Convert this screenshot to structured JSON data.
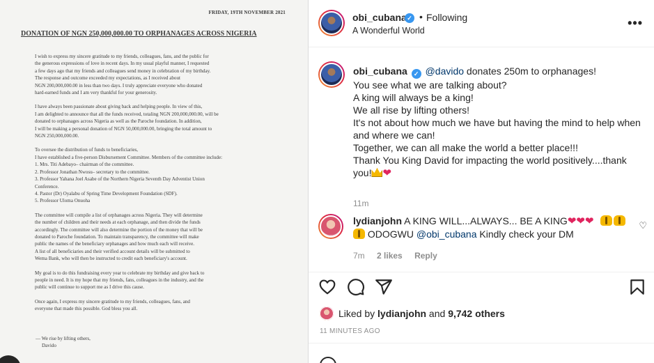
{
  "document": {
    "date": "FRIDAY, 19TH NOVEMBER 2021",
    "title": "DONATION OF NGN 250,000,000.00 TO ORPHANAGES ACROSS NIGERIA",
    "paragraphs": [
      [
        "I wish to express my sincere gratitude to my friends, colleagues, fans, and the public for",
        "the generous expressions of love in recent days. In my usual playful manner, I requested",
        "a few days ago that my friends and colleagues send money in celebration of my birthday.",
        "The response and outcome exceeded my expectations, as I received about",
        "NGN 200,000,000.00 in less than two days. I truly appreciate everyone who donated",
        "hard-earned funds and I am very thankful for your generosity."
      ],
      [
        "I have always been passionate about giving back and helping people. In view of this,",
        "I am delighted to announce that all the funds received, totaling NGN 200,000,000.00, will be",
        "donated to orphanages across Nigeria as well as the Paroche foundation. In addition,",
        "I will be making a personal donation of NGN 50,000,000.00, bringing the total amount to",
        "NGN 250,000,000.00."
      ],
      [
        "To oversee the distribution of funds to beneficiaries,",
        "I have established a five-person Disbursement Committee. Members of the committee include:",
        "1. Mrs. Titi Adebayo– chairman of the committee.",
        "2. Professor Jonathan Nwosu– secretary to the committee.",
        "3. Professor Yahana Joel Asabe of the Northern Nigeria Seventh Day Adventist Union",
        "Conference.",
        "4. Pastor (Dr) Oyalabu of Spring Time Development Foundation (SDF).",
        "5. Professor Uloma Onuoha"
      ],
      [
        "The committee will compile a list of orphanages across Nigeria. They will determine",
        "the number of children and their needs at each orphanage, and then divide the funds",
        "accordingly. The committee will also determine the portion of the money that will be",
        "donated to Paroche foundation. To maintain transparency, the committee will make",
        "public the names of the beneficiary orphanages and how much each will receive.",
        "A list of all beneficiaries and their verified account details will be submitted to",
        "Wema Bank, who will then be instructed to credit each beneficiary's account."
      ],
      [
        "My goal is to do this fundraising every year to celebrate my birthday and give back to",
        "people in need. It is my hope that my friends, fans, colleagues in the industry, and the",
        "public will continue to support me as I drive this cause."
      ],
      [
        "Once again, I express my sincere gratitude to my friends, colleagues, fans, and",
        "everyone that made this possible. God bless you all."
      ]
    ],
    "signoff": "— We rise by lifting others,",
    "signature": "Davido"
  },
  "header": {
    "username": "obi_cubana",
    "verified_glyph": "✓",
    "dot": "•",
    "follow_status": "Following",
    "location": "A Wonderful World",
    "more": "•••"
  },
  "caption": {
    "username": "obi_cubana",
    "mention": "@davido",
    "first_line_rest": " donates 250m to orphanages!",
    "lines": [
      "You see what we are talking about?",
      "A king will always be a king!",
      "We all rise by lifting others!",
      "It's not about how much we have but having the mind to help when",
      "and where we can!",
      "Together, we can all make the world a better place!!!",
      "Thank You King David for impacting the world positively....thank",
      "you!"
    ],
    "time": "11m"
  },
  "reply": {
    "username": "lydianjohn",
    "text_1": " A KING WILL...ALWAYS... BE A KING",
    "text_2": " ODOGWU ",
    "mention": "@obi_cubana",
    "text_3": " Kindly check your DM",
    "time": "7m",
    "likes": "2 likes",
    "reply_label": "Reply",
    "heart": "♡",
    "heart_filled": "❤"
  },
  "likes": {
    "prefix": "Liked by ",
    "user": "lydianjohn",
    "middle": " and ",
    "count": "9,742 others"
  },
  "post_time": "11 MINUTES AGO",
  "colors": {
    "link": "#00376b",
    "verified": "#3897f0",
    "muted": "#8e8e8e",
    "heart": "#e0245e"
  },
  "icons": [
    "heart-icon",
    "comment-icon",
    "share-icon",
    "bookmark-icon",
    "more-icon",
    "verified-icon",
    "emoji-icon"
  ]
}
